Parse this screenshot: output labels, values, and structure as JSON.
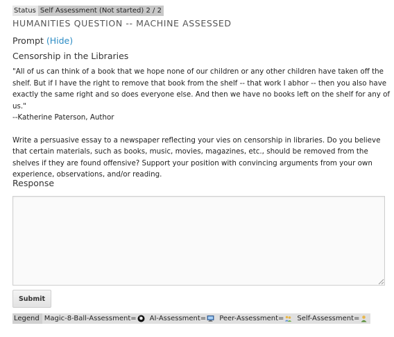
{
  "status": {
    "label": "Status",
    "value": "Self Assessment (Not started) 2 / 2"
  },
  "question_type": "HUMANITIES QUESTION -- MACHINE ASSESSED",
  "prompt": {
    "heading": "Prompt",
    "hide_link": "(Hide)",
    "title": "Censorship in the Libraries",
    "quote": "\"All of us can think of a book that we hope none of our children or any other children have taken off the shelf. But if I have the right to remove that book from the shelf -- that work I abhor -- then you also have exactly the same right and so does everyone else. And then we have no books left on the shelf for any of us.\"",
    "attribution": "--Katherine Paterson, Author",
    "instructions": "Write a persuasive essay to a newspaper reflecting your vies on censorship in libraries. Do you believe that certain materials, such as books, music, movies, magazines, etc., should be removed from the shelves if they are found offensive? Support your position with convincing arguments from your own experience, observations, and/or reading."
  },
  "response": {
    "heading": "Response",
    "value": ""
  },
  "submit_label": "Submit",
  "legend": {
    "label": "Legend",
    "items": [
      {
        "label": "Magic-8-Ball-Assessment=",
        "icon": "magic-8-ball-icon"
      },
      {
        "label": "AI-Assessment=",
        "icon": "computer-icon"
      },
      {
        "label": "Peer-Assessment=",
        "icon": "peers-icon"
      },
      {
        "label": "Self-Assessment=",
        "icon": "person-icon"
      }
    ]
  }
}
